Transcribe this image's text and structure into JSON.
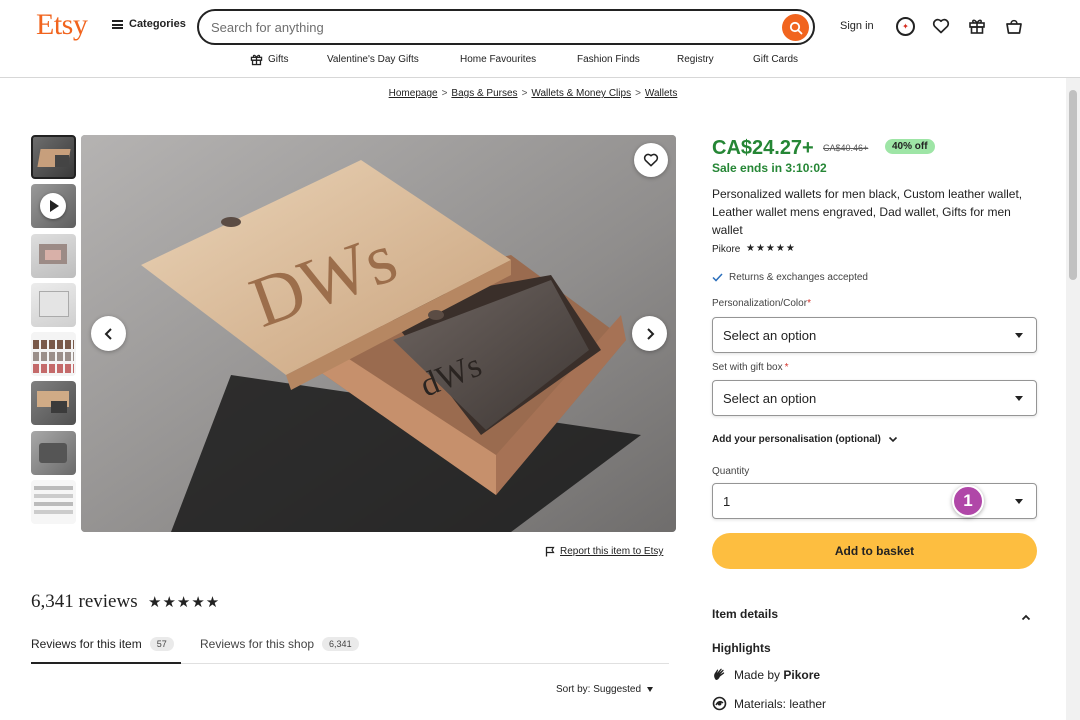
{
  "header": {
    "logo": "Etsy",
    "categories_label": "Categories",
    "search_placeholder": "Search for anything",
    "sign_in_label": "Sign in"
  },
  "subnav": {
    "gifts": "Gifts",
    "valentines": "Valentine's Day Gifts",
    "home_favourites": "Home Favourites",
    "fashion_finds": "Fashion Finds",
    "registry": "Registry",
    "gift_cards": "Gift Cards"
  },
  "breadcrumb": {
    "homepage": "Homepage",
    "bags": "Bags & Purses",
    "wallets_clips": "Wallets & Money Clips",
    "wallets": "Wallets",
    "separator": ">"
  },
  "gallery": {
    "thumbnail_count": 8,
    "selected_thumbnail": 1,
    "box_lid_text": "DWs",
    "wallet_text": "dWs"
  },
  "report_label": "Report this item to Etsy",
  "reviews": {
    "count_label": "6,341 reviews",
    "stars": "★★★★★",
    "tab_item_label": "Reviews for this item",
    "tab_item_count": "57",
    "tab_shop_label": "Reviews for this shop",
    "tab_shop_count": "6,341",
    "sort_label": "Sort by: Suggested"
  },
  "product": {
    "price": "CA$24.27+",
    "original_price": "CA$40.46+",
    "discount": "40% off",
    "sale_ends": "Sale ends in 3:10:02",
    "title": "Personalized wallets for men black, Custom leather wallet, Leather wallet mens engraved, Dad wallet, Gifts for men wallet",
    "shop_name": "Pikore",
    "shop_stars": "★★★★★",
    "returns": "Returns & exchanges accepted",
    "option1_label": "Personalization/Color",
    "option1_value": "Select an option",
    "option2_label": "Set with gift box",
    "option2_value": "Select an option",
    "required_mark": "*",
    "personalisation_label": "Add your personalisation (optional)",
    "quantity_label": "Quantity",
    "quantity_value": "1",
    "marker_number": "1",
    "add_to_basket": "Add to basket",
    "item_details": "Item details",
    "highlights": "Highlights",
    "made_by_prefix": "Made by ",
    "made_by_shop": "Pikore",
    "materials": "Materials: leather"
  },
  "colors": {
    "brand": "#f1641e",
    "price_green": "#258635",
    "discount_bg": "#9ee5a6",
    "button_yellow": "#fdbe40",
    "marker_purple": "#b047a8"
  }
}
